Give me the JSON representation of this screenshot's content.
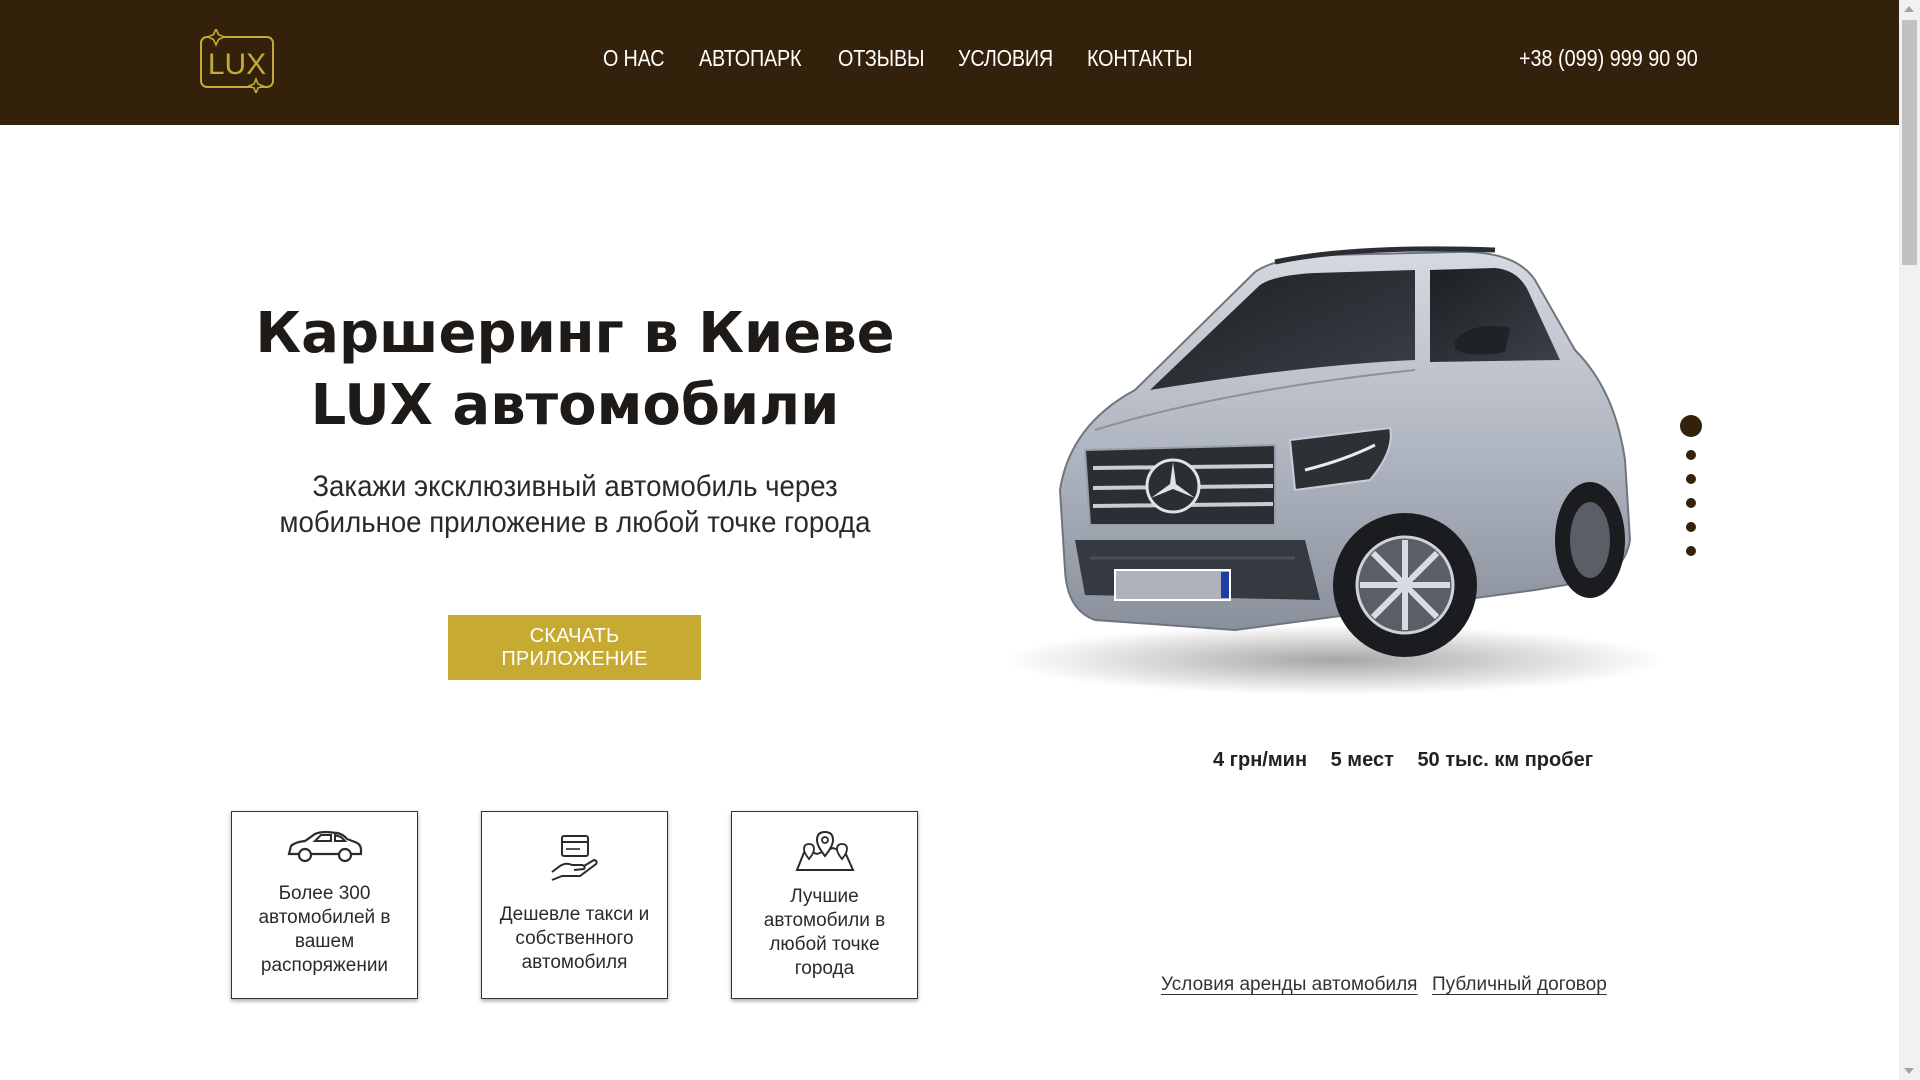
{
  "header": {
    "logo_text": "LUX",
    "nav": [
      {
        "label": "О НАС"
      },
      {
        "label": "АВТОПАРК"
      },
      {
        "label": "ОТЗЫВЫ"
      },
      {
        "label": "УСЛОВИЯ"
      },
      {
        "label": "КОНТАКТЫ"
      }
    ],
    "phone": "+38 (099) 999 90 90"
  },
  "hero": {
    "title_line1": "Каршеринг в Киеве",
    "title_line2": "LUX автомобили",
    "subtitle_line1": "Закажи эксклюзивный автомобиль через",
    "subtitle_line2": "мобильное приложение в любой точке города",
    "cta_label": "СКАЧАТЬ ПРИЛОЖЕНИЕ"
  },
  "car": {
    "specs": [
      "4 грн/мин",
      "5 мест",
      "50 тыс. км пробег"
    ],
    "slider": {
      "count": 6,
      "active_index": 0
    }
  },
  "features": [
    {
      "icon": "car-icon",
      "text": [
        "Более 300",
        "автомобилей в",
        "вашем",
        "распоряжении"
      ]
    },
    {
      "icon": "card-in-hand-icon",
      "text": [
        "Дешевле такси и",
        "собственного",
        "автомобиля"
      ]
    },
    {
      "icon": "map-pins-icon",
      "text": [
        "Лучшие",
        "автомобили в",
        "любой точке",
        "города"
      ]
    }
  ],
  "footer_links": [
    {
      "label": "Условия аренды автомобиля"
    },
    {
      "label": "Публичный договор"
    }
  ],
  "colors": {
    "header_bg": "#33210b",
    "accent_gold": "#c6aa31",
    "text_dark": "#1e1a17"
  }
}
